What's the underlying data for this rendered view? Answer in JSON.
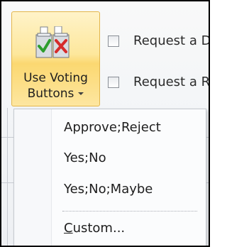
{
  "vote_button": {
    "line1": "Use Voting",
    "line2": "Buttons"
  },
  "options": [
    {
      "label": "Request a D"
    },
    {
      "label": "Request a R"
    }
  ],
  "menu": {
    "items": [
      {
        "label": "Approve;Reject"
      },
      {
        "label": "Yes;No"
      },
      {
        "label": "Yes;No;Maybe"
      }
    ],
    "custom_label": "Custom..."
  },
  "colors": {
    "button_highlight": "#fde79c",
    "button_border": "#e3b64b",
    "check_green": "#2e9d2e",
    "x_red": "#d62b2b"
  }
}
